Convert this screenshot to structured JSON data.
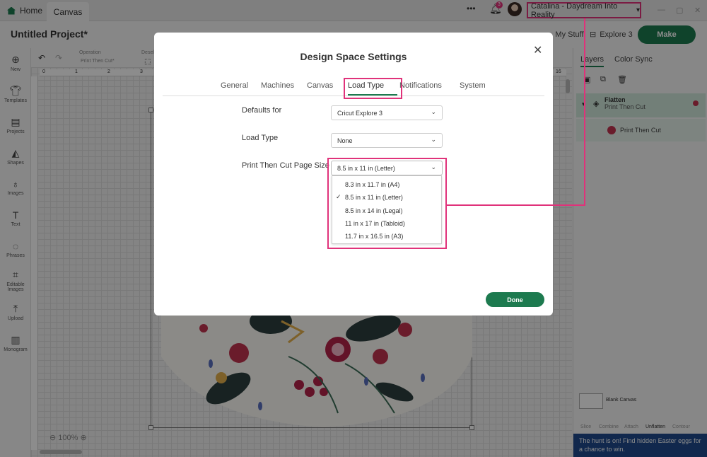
{
  "titlebar": {
    "home_label": "Home",
    "canvas_tab": "Canvas",
    "more": "•••",
    "notification_count": "3",
    "user_menu": "Catalina - Daydream Into Reality"
  },
  "header": {
    "project_title": "Untitled Project*",
    "my_stuff": "My Stuff",
    "machine": "Explore 3",
    "make": "Make"
  },
  "sidebar": {
    "items": [
      {
        "label": "New",
        "icon": "plus-circle-icon"
      },
      {
        "label": "Templates",
        "icon": "shirt-icon"
      },
      {
        "label": "Projects",
        "icon": "projects-icon"
      },
      {
        "label": "Shapes",
        "icon": "shapes-icon"
      },
      {
        "label": "Images",
        "icon": "lightbulb-icon"
      },
      {
        "label": "Text",
        "icon": "text-icon"
      },
      {
        "label": "Phrases",
        "icon": "speech-bubble-icon"
      },
      {
        "label": "Editable Images",
        "icon": "editable-images-icon"
      },
      {
        "label": "Upload",
        "icon": "upload-icon"
      },
      {
        "label": "Monogram",
        "icon": "monogram-icon"
      }
    ]
  },
  "editbar": {
    "operation_label": "Operation",
    "operation_value": "Print Then Cut*",
    "deselect_label": "Deselect"
  },
  "rulers": {
    "top_ticks": [
      "0",
      "1",
      "2",
      "3",
      "16"
    ]
  },
  "canvas": {
    "zoom": "100%"
  },
  "right_panel": {
    "tabs": [
      "Layers",
      "Color Sync"
    ],
    "layer_group_name": "Flatten",
    "layer_group_type": "Print Then Cut",
    "layer_child": "Print Then Cut",
    "blank_canvas": "Blank Canvas",
    "bottom_actions": [
      "Slice",
      "Combine",
      "Attach",
      "Unflatten",
      "Contour"
    ],
    "banner": "The hunt is on! Find hidden Easter eggs for a chance to win."
  },
  "modal": {
    "title": "Design Space Settings",
    "tabs": [
      "General",
      "Machines",
      "Canvas",
      "Load Type",
      "Notifications",
      "System"
    ],
    "active_tab": "Load Type",
    "defaults_for_label": "Defaults for",
    "defaults_for_value": "Cricut Explore 3",
    "load_type_label": "Load Type",
    "load_type_value": "None",
    "page_size_label": "Print Then Cut Page Size",
    "page_size_value": "8.5 in x 11 in (Letter)",
    "page_size_options": [
      "8.3 in x 11.7 in (A4)",
      "8.5 in x 11 in (Letter)",
      "8.5 in x 14 in (Legal)",
      "11 in x 17 in (Tabloid)",
      "11.7 in x 16.5 in (A3)"
    ],
    "selected_option_index": 1,
    "done": "Done"
  },
  "colors": {
    "accent_green": "#1d7a4f",
    "highlight_pink": "#e0327a"
  }
}
